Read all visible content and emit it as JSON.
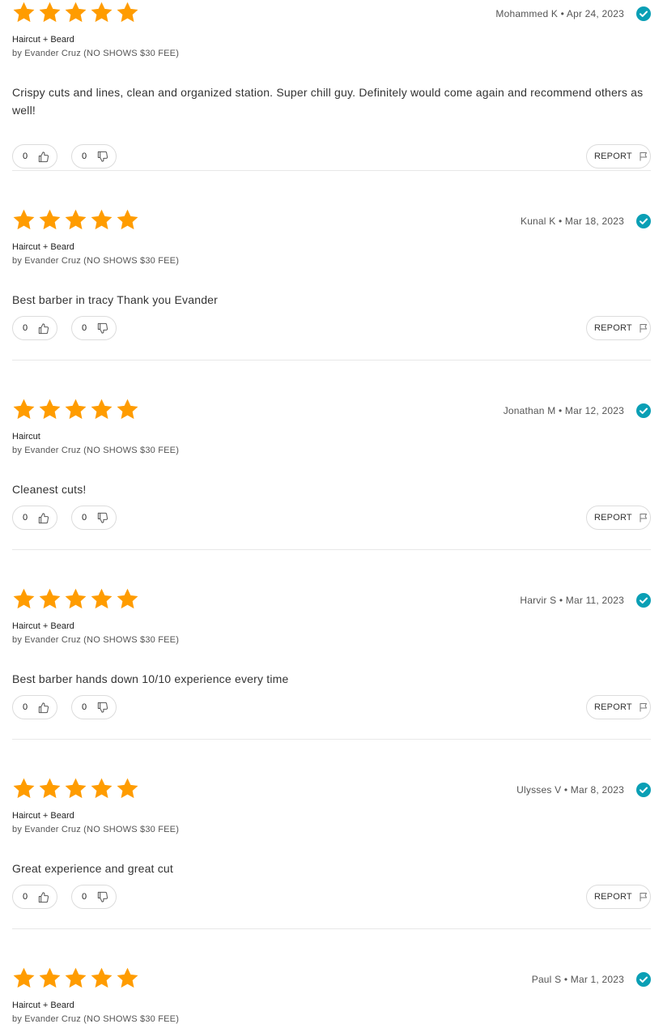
{
  "colors": {
    "star": "#ff9c00",
    "verified": "#0a9fb5",
    "divider": "#e8e8e8",
    "button_border": "#dcdcdc"
  },
  "icons": {
    "star": "star-icon",
    "verified": "verified-check-icon",
    "like": "thumbs-up-icon",
    "dislike": "thumbs-down-icon",
    "report": "flag-icon"
  },
  "reviews": [
    {
      "rating": 5,
      "author": "Mohammed K",
      "date": "Apr 24, 2023",
      "meta": "Mohammed K • Apr 24, 2023",
      "service": "Haircut + Beard",
      "provider": "by Evander Cruz (NO SHOWS $30 FEE)",
      "text": "Crispy cuts and lines, clean and organized station. Super chill guy. Definitely would come again and recommend others as well!",
      "likes": "0",
      "dislikes": "0",
      "report_label": "REPORT"
    },
    {
      "rating": 5,
      "author": "Kunal K",
      "date": "Mar 18, 2023",
      "meta": "Kunal K • Mar 18, 2023",
      "service": "Haircut + Beard",
      "provider": "by Evander Cruz (NO SHOWS $30 FEE)",
      "text": "Best barber in tracy Thank you Evander",
      "likes": "0",
      "dislikes": "0",
      "report_label": "REPORT"
    },
    {
      "rating": 5,
      "author": "Jonathan M",
      "date": "Mar 12, 2023",
      "meta": "Jonathan M • Mar 12, 2023",
      "service": "Haircut",
      "provider": "by Evander Cruz (NO SHOWS $30 FEE)",
      "text": "Cleanest cuts!",
      "likes": "0",
      "dislikes": "0",
      "report_label": "REPORT"
    },
    {
      "rating": 5,
      "author": "Harvir S",
      "date": "Mar 11, 2023",
      "meta": "Harvir S • Mar 11, 2023",
      "service": "Haircut + Beard",
      "provider": "by Evander Cruz (NO SHOWS $30 FEE)",
      "text": "Best barber hands down 10/10 experience every time",
      "likes": "0",
      "dislikes": "0",
      "report_label": "REPORT"
    },
    {
      "rating": 5,
      "author": "Ulysses V",
      "date": "Mar 8, 2023",
      "meta": "Ulysses V • Mar 8, 2023",
      "service": "Haircut + Beard",
      "provider": "by Evander Cruz (NO SHOWS $30 FEE)",
      "text": "Great experience and great cut",
      "likes": "0",
      "dislikes": "0",
      "report_label": "REPORT"
    },
    {
      "rating": 5,
      "author": "Paul S",
      "date": "Mar 1, 2023",
      "meta": "Paul S • Mar 1, 2023",
      "service": "Haircut + Beard",
      "provider": "by Evander Cruz (NO SHOWS $30 FEE)"
    }
  ]
}
